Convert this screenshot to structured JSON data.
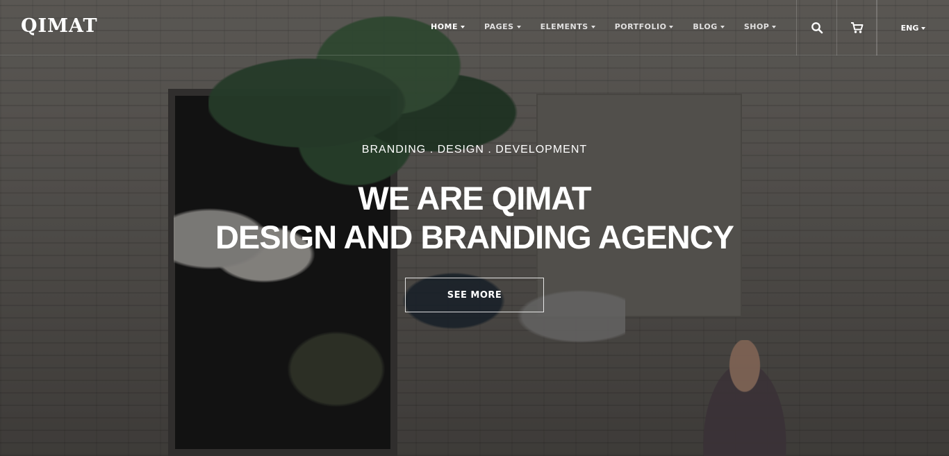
{
  "header": {
    "logo_text": "QIMAT",
    "nav": [
      {
        "label": "HOME",
        "active": true
      },
      {
        "label": "PAGES",
        "active": false
      },
      {
        "label": "ELEMENTS",
        "active": false
      },
      {
        "label": "PORTFOLIO",
        "active": false
      },
      {
        "label": "BLOG",
        "active": false
      },
      {
        "label": "SHOP",
        "active": false
      }
    ],
    "tools": {
      "search_icon": "search-icon",
      "cart_icon": "cart-icon",
      "language": "ENG"
    }
  },
  "hero": {
    "kicker": "BRANDING . DESIGN . DEVELOPMENT",
    "title_line1": "WE ARE QIMAT",
    "title_line2": "DESIGN AND BRANDING AGENCY",
    "cta_label": "SEE MORE"
  },
  "colors": {
    "text": "#ffffff",
    "overlay": "#000000"
  }
}
